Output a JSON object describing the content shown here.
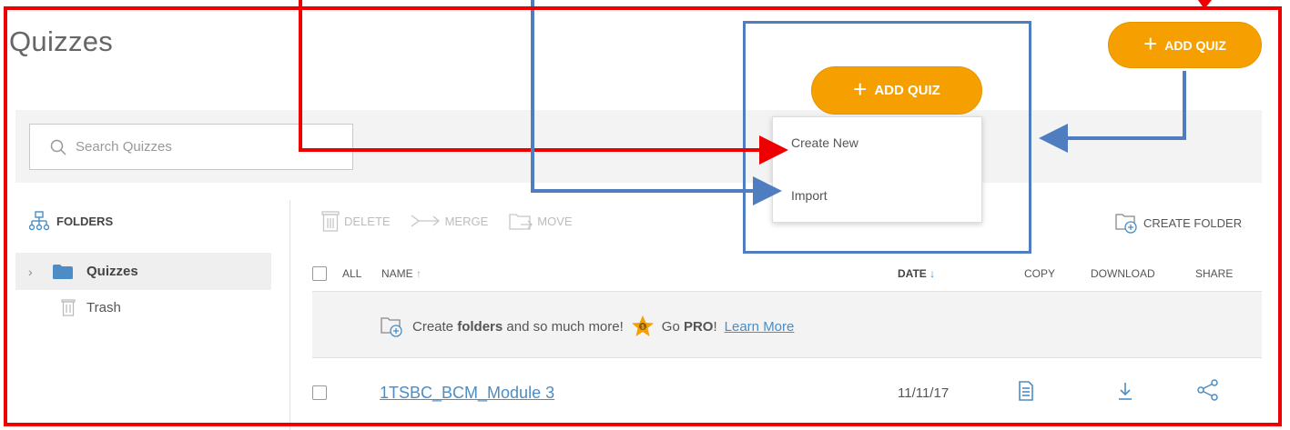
{
  "header": {
    "title": "Quizzes",
    "add_quiz_label": "ADD QUIZ"
  },
  "search": {
    "placeholder": "Search Quizzes"
  },
  "dropdown": {
    "items": [
      {
        "label": "Create New"
      },
      {
        "label": "Import"
      }
    ]
  },
  "sidebar": {
    "heading": "FOLDERS",
    "items": [
      {
        "label": "Quizzes",
        "icon": "folder-icon",
        "active": true
      },
      {
        "label": "Trash",
        "icon": "trash-icon"
      }
    ]
  },
  "toolbar": {
    "delete_label": "DELETE",
    "merge_label": "MERGE",
    "move_label": "MOVE",
    "create_folder_label": "CREATE FOLDER"
  },
  "table": {
    "headers": {
      "all": "ALL",
      "name": "NAME",
      "date": "DATE",
      "copy": "COPY",
      "download": "DOWNLOAD",
      "share": "SHARE"
    },
    "sort": {
      "name": "ascending",
      "date": "descending"
    },
    "promo": {
      "text_before": "Create ",
      "text_bold": "folders",
      "text_after": " and so much more!",
      "go": "Go ",
      "pro": "PRO",
      "exclaim": "!",
      "learn_more": "Learn More"
    },
    "rows": [
      {
        "name": "1TSBC_BCM_Module 3",
        "date": "11/11/17"
      }
    ]
  },
  "colors": {
    "accent": "#f5a000",
    "link": "#4b8dc4",
    "annotation_red": "#ee0000",
    "annotation_blue": "#4f7ec0"
  }
}
